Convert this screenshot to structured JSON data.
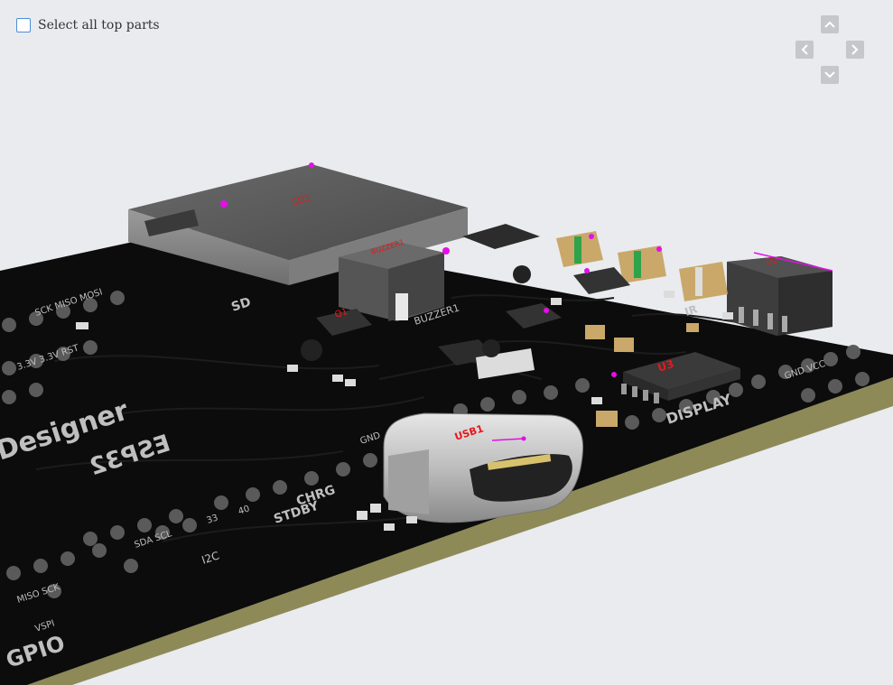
{
  "toolbar": {
    "select_all_label": "Select all top parts",
    "select_all_checked": false
  },
  "view_controls": {
    "up_icon": "chevron-up-icon",
    "left_icon": "chevron-left-icon",
    "right_icon": "chevron-right-icon",
    "down_icon": "chevron-down-icon"
  },
  "board": {
    "silkscreen": {
      "designer": "Designer",
      "esp32": "ESP32",
      "gpio": "GPIO",
      "display": "DISPLAY",
      "sd": "SD",
      "buzzer": "BUZZER1",
      "chrg": "CHRG",
      "stdby": "STDBY",
      "ir": "IR",
      "i2c": "I2C",
      "pins_spi": "SCK MISO MOSI",
      "pins_power": "3.3V 3.3V RST",
      "pins_i2c": "SDA SCL",
      "pins_spi2": "MISO SCK",
      "vspi": "VSPI",
      "gnd": "GND",
      "gnd_vcc": "GND VCC",
      "pin_33": "33",
      "pin_40": "40"
    },
    "designators": {
      "usb": "USB1",
      "u3": "U3",
      "u2": "U2",
      "q1": "Q1",
      "sd_module": "SD1",
      "buzzer_ref": "BUZZER1"
    }
  },
  "colors": {
    "background": "#e9ebee",
    "board": "#0b0b0b",
    "board_edge": "#8d8a58",
    "copper_pad": "#5a5a5a",
    "silk": "#bfbfbf",
    "designator": "#e3191e",
    "marker": "#e60ee6",
    "checkbox_border": "#4d8fd6"
  }
}
